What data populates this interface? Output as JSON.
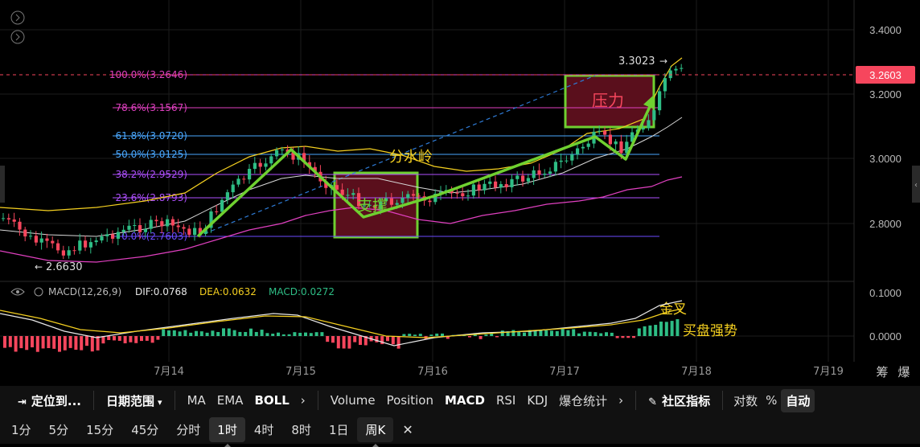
{
  "price_axis": [
    "3.4000",
    "3.2000",
    "3.0000",
    "2.8000"
  ],
  "current_price": "3.2603",
  "macd_axis": [
    "0.1000",
    "0.0000"
  ],
  "date_axis": [
    "7月14",
    "7月15",
    "7月16",
    "7月17",
    "7月18",
    "7月19"
  ],
  "axis_corner": [
    "筹",
    "爆"
  ],
  "fib_levels": [
    {
      "label": "100.0%(3.2646)",
      "color": "#e040c0"
    },
    {
      "label": "78.6%(3.1567)",
      "color": "#e040c0"
    },
    {
      "label": "61.8%(3.0720)",
      "color": "#4aa8ff"
    },
    {
      "label": "50.0%(3.0125)",
      "color": "#4aa8ff"
    },
    {
      "label": "38.2%(2.9529)",
      "color": "#b050ff"
    },
    {
      "label": "23.6%(2.8793)",
      "color": "#b050ff"
    },
    {
      "label": "0.0%(2.7603)",
      "color": "#6c4cff"
    }
  ],
  "annotations": {
    "high_price": "3.3023",
    "low_price": "2.6630",
    "resistance_label": "压力",
    "support_label": "支撑",
    "watershed_label": "分水岭",
    "golden_cross_label": "金叉",
    "buying_power_label": "买盘强势"
  },
  "macd_legend": {
    "name": "MACD(12,26,9)",
    "dif": "DIF:0.0768",
    "dea": "DEA:0.0632",
    "macd": "MACD:0.0272"
  },
  "toolbar": {
    "locate": "定位到...",
    "date_range": "日期范围",
    "ma": "MA",
    "ema": "EMA",
    "boll": "BOLL",
    "volume": "Volume",
    "position": "Position",
    "macd": "MACD",
    "rsi": "RSI",
    "kdj": "KDJ",
    "liquidation": "爆仓统计",
    "community": "社区指标",
    "log": "对数",
    "percent": "%",
    "auto": "自动"
  },
  "timeframes": [
    "1分",
    "5分",
    "15分",
    "45分",
    "分时",
    "1时",
    "4时",
    "8时",
    "1日",
    "周K"
  ],
  "selected_timeframe": "1时",
  "colors": {
    "up": "#2ebd85",
    "down": "#f6465d",
    "fib_pink": "#e040c0",
    "fib_blue": "#4aa8ff",
    "fib_purple": "#b050ff",
    "pattern": "#6fd030",
    "box_fill": "#5a0f1c",
    "current_tag": "#f6465d"
  }
}
